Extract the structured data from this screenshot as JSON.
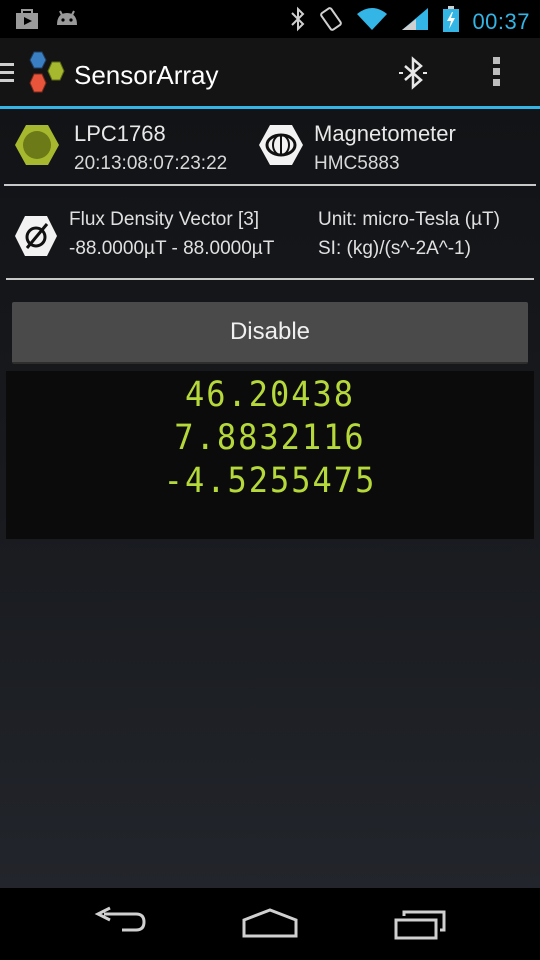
{
  "status_bar": {
    "time": "00:37",
    "icons": [
      "play-store-icon",
      "android-icon",
      "bluetooth-icon",
      "rotation-icon",
      "wifi-icon",
      "signal-icon",
      "battery-charging-icon"
    ]
  },
  "action_bar": {
    "title": "SensorArray",
    "icons": [
      "menu-lines-icon",
      "app-logo-hexagons-icon",
      "bluetooth-icon",
      "overflow-menu-icon"
    ]
  },
  "device": {
    "name": "LPC1768",
    "address": "20:13:08:07:23:22",
    "icon": "device-hexagon-icon",
    "accent": "#a6b82e"
  },
  "sensor": {
    "name": "Magnetometer",
    "model": "HMC5883",
    "icon": "magnetometer-coil-icon"
  },
  "property": {
    "name": "Flux Density Vector [3]",
    "range": "-88.0000µT - 88.0000µT",
    "unit": "Unit: micro-Tesla (µT)",
    "si": "SI: (kg)/(s^-2A^-1)",
    "icon": "flux-vector-icon"
  },
  "disable_button": {
    "label": "Disable"
  },
  "readings": [
    "46.20438",
    "7.8832116",
    "-4.5255475"
  ],
  "readout_color": "#b5d83a",
  "nav_bar": {
    "icons": [
      "back-icon",
      "home-icon",
      "recents-icon"
    ]
  }
}
